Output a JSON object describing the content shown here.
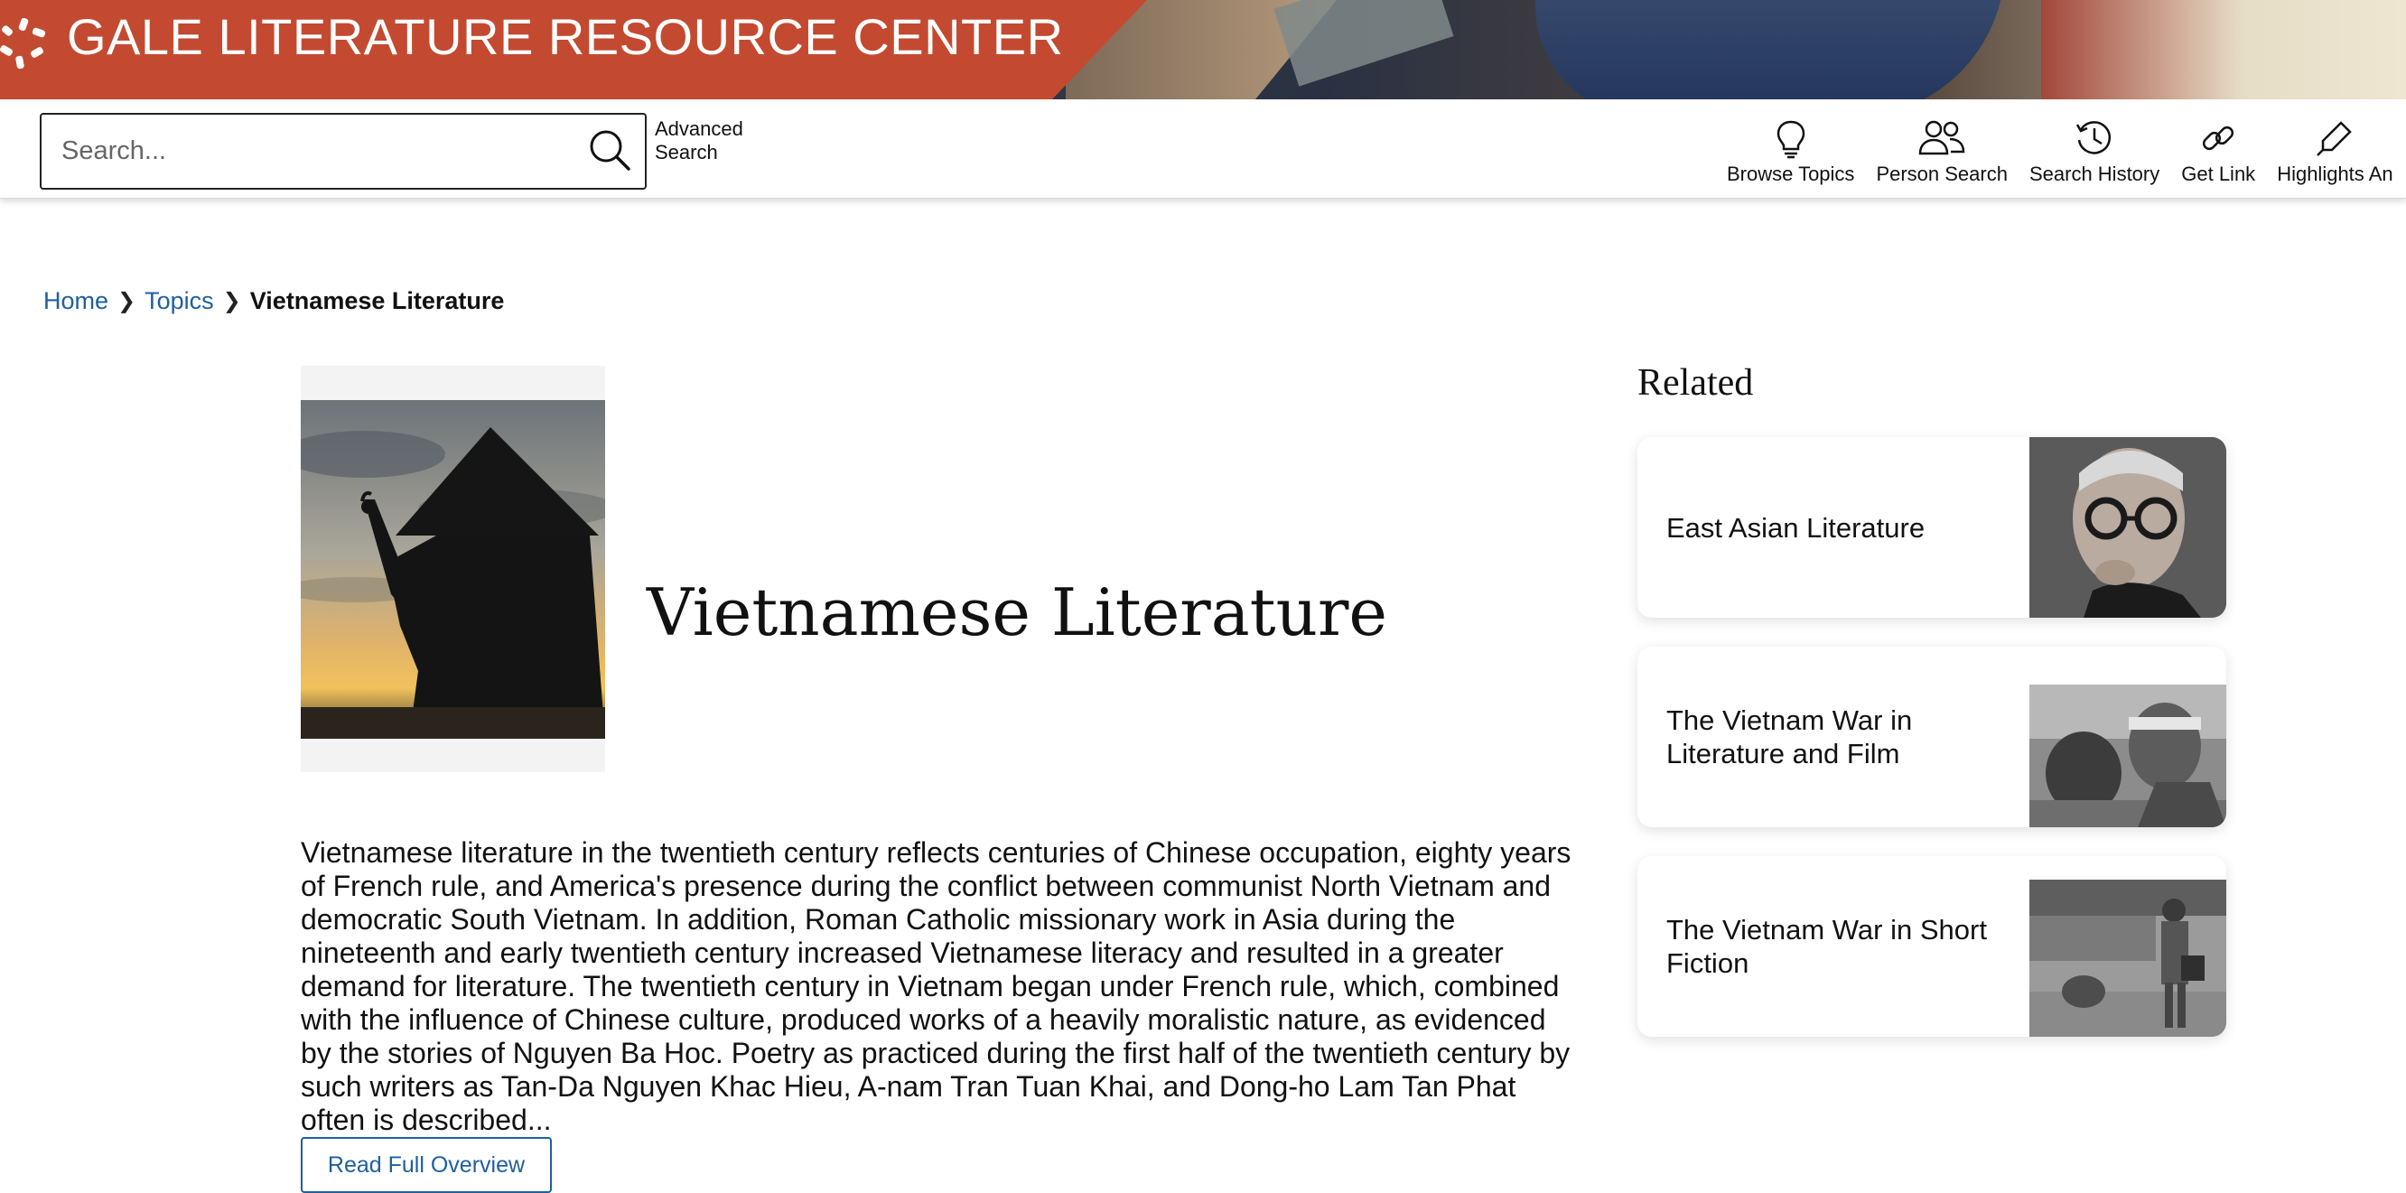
{
  "app": {
    "title": "GALE LITERATURE RESOURCE CENTER",
    "brand_color": "#c34a30",
    "logo_icon": "gale-logo-icon"
  },
  "search": {
    "placeholder": "Search...",
    "value": "",
    "icon": "search-icon",
    "advanced_label": "Advanced Search"
  },
  "tools": [
    {
      "label": "Browse Topics",
      "icon": "lightbulb-icon"
    },
    {
      "label": "Person Search",
      "icon": "people-icon"
    },
    {
      "label": "Search History",
      "icon": "history-icon"
    },
    {
      "label": "Get Link",
      "icon": "link-icon"
    },
    {
      "label": "Highlights An",
      "icon": "highlighter-icon"
    }
  ],
  "breadcrumb": {
    "home": "Home",
    "topics": "Topics",
    "current": "Vietnamese Literature",
    "link_color": "#1f5fa0"
  },
  "topic": {
    "title": "Vietnamese Literature",
    "image": "silhouette-conical-hat-photo",
    "overview": "Vietnamese literature in the twentieth century reflects centuries of Chinese occupation, eighty years of French rule, and America's presence during the conflict between communist North Vietnam and democratic South Vietnam. In addition, Roman Catholic missionary work in Asia during the nineteenth and early twentieth century increased Vietnamese literacy and resulted in a greater demand for literature. The twentieth century in Vietnam began under French rule, which, combined with the influence of Chinese culture, produced works of a heavily moralistic nature, as evidenced by the stories of Nguyen Ba Hoc. Poetry as practiced during the first half of the twentieth century by such writers as Tan-Da Nguyen Khac Hieu, A-nam Tran Tuan Khai, and Dong-ho Lam Tan Phat often is described...",
    "read_more_label": "Read Full Overview"
  },
  "related": {
    "heading": "Related",
    "items": [
      {
        "label": "East Asian Literature",
        "image": "man-with-glasses-photo"
      },
      {
        "label": "The Vietnam War in Literature and Film",
        "image": "soldiers-film-still-photo"
      },
      {
        "label": "The Vietnam War in Short Fiction",
        "image": "soldier-village-photo"
      }
    ]
  }
}
